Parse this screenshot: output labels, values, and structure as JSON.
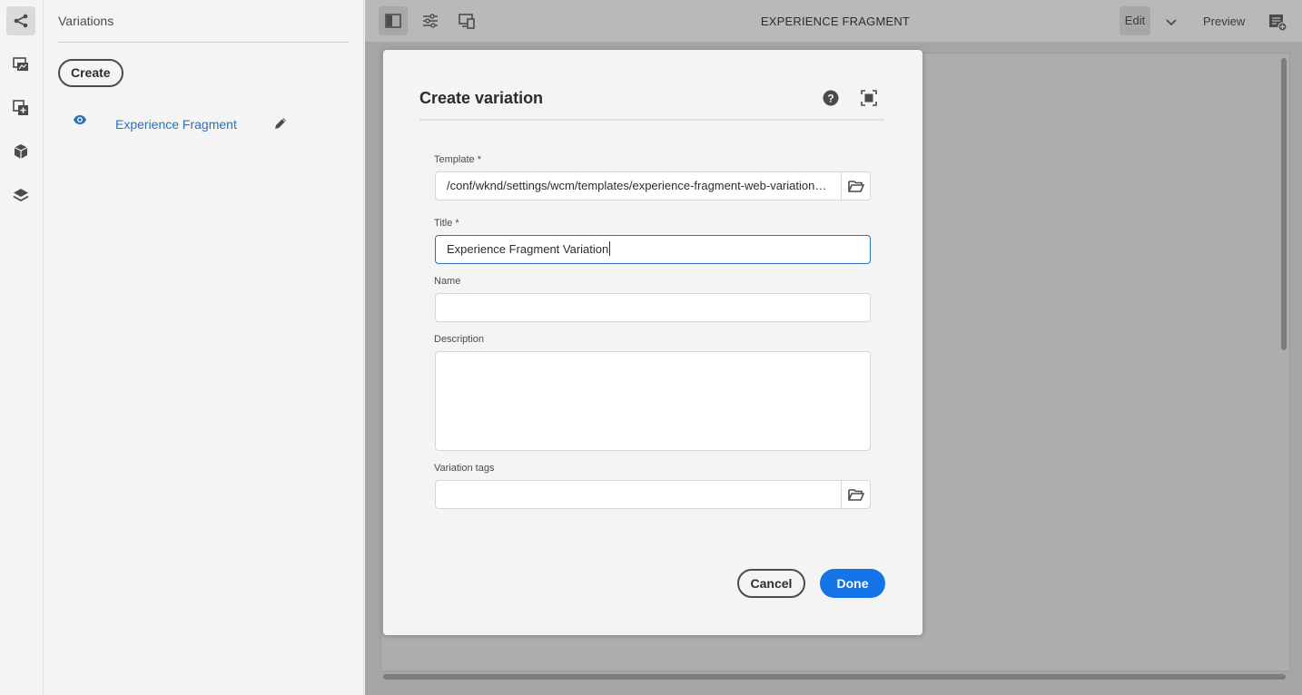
{
  "rail": {
    "items": [
      {
        "icon": "share-tree-icon",
        "active": true
      },
      {
        "icon": "assets-icon",
        "active": false
      },
      {
        "icon": "components-icon",
        "active": false
      },
      {
        "icon": "packages-icon",
        "active": false
      },
      {
        "icon": "layers-icon",
        "active": false
      }
    ]
  },
  "side": {
    "title": "Variations",
    "create_label": "Create",
    "variations": [
      {
        "label": "Experience Fragment"
      }
    ]
  },
  "topbar": {
    "title": "EXPERIENCE FRAGMENT",
    "edit_label": "Edit",
    "preview_label": "Preview"
  },
  "dialog": {
    "title": "Create variation",
    "fields": {
      "template": {
        "label": "Template *",
        "value": "/conf/wknd/settings/wcm/templates/experience-fragment-web-variation-template"
      },
      "title": {
        "label": "Title *",
        "value": "Experience Fragment Variation"
      },
      "name": {
        "label": "Name",
        "value": ""
      },
      "description": {
        "label": "Description",
        "value": ""
      },
      "tags": {
        "label": "Variation tags",
        "value": ""
      }
    },
    "cancel_label": "Cancel",
    "done_label": "Done"
  },
  "colors": {
    "accent": "#1473e6",
    "link": "#2c6fbd",
    "overlay": "#a5a5a5"
  }
}
